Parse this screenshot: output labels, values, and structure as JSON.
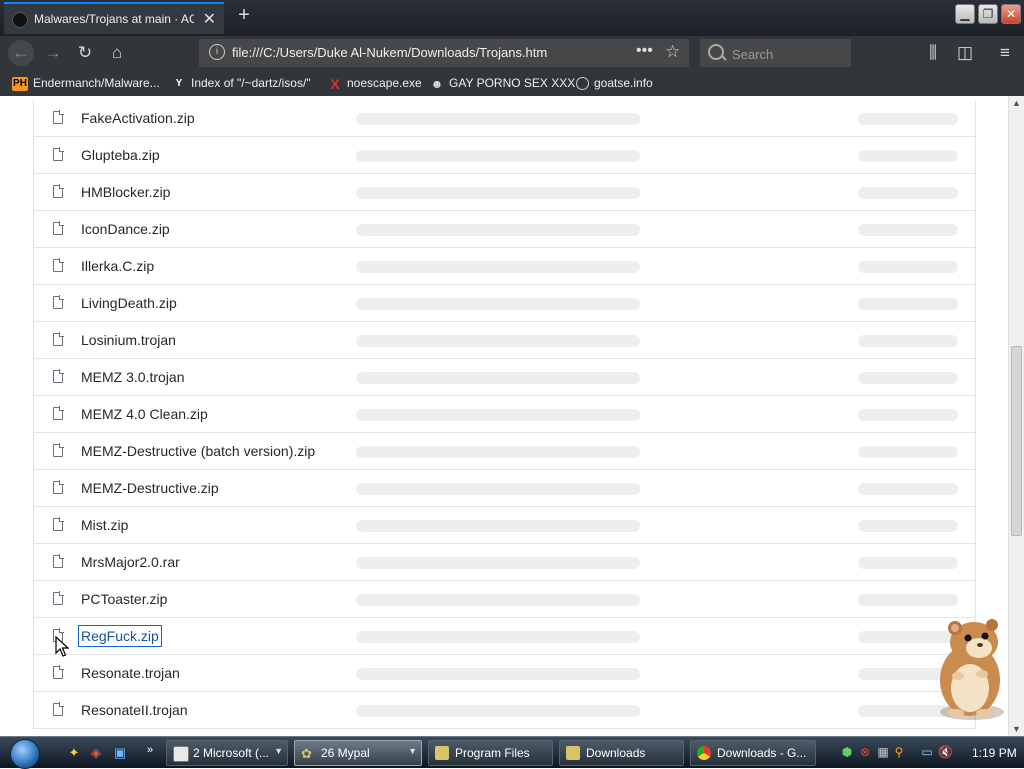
{
  "browser": {
    "tab_title": "Malwares/Trojans at main · AG",
    "new_tab_symbol": "+",
    "url": "file:///C:/Users/Duke Al-Nukem/Downloads/Trojans.htm",
    "search_placeholder": "Search",
    "accent_color": "#0a84ff"
  },
  "bookmarks": [
    {
      "icon": "PH",
      "label": "Endermanch/Malware..."
    },
    {
      "icon": "Y",
      "label": "Index of \"/~dartz/isos/\""
    },
    {
      "icon": "X",
      "label": "noescape.exe"
    },
    {
      "icon": "mask-icon",
      "label": "GAY PORNO SEX XXX"
    },
    {
      "icon": "globe-icon",
      "label": "goatse.info"
    }
  ],
  "files": [
    {
      "name": "FakeActivation.zip"
    },
    {
      "name": "Glupteba.zip"
    },
    {
      "name": "HMBlocker.zip"
    },
    {
      "name": "IconDance.zip"
    },
    {
      "name": "Illerka.C.zip"
    },
    {
      "name": "LivingDeath.zip"
    },
    {
      "name": "Losinium.trojan"
    },
    {
      "name": "MEMZ 3.0.trojan"
    },
    {
      "name": "MEMZ 4.0 Clean.zip"
    },
    {
      "name": "MEMZ-Destructive (batch version).zip"
    },
    {
      "name": "MEMZ-Destructive.zip"
    },
    {
      "name": "Mist.zip"
    },
    {
      "name": "MrsMajor2.0.rar"
    },
    {
      "name": "PCToaster.zip"
    },
    {
      "name": "RegFuck.zip",
      "focused": true
    },
    {
      "name": "Resonate.trojan"
    },
    {
      "name": "ResonateII.trojan"
    }
  ],
  "taskbar": {
    "buttons": [
      {
        "label": "2 Microsoft (...",
        "icon": "window-icon"
      },
      {
        "label": "26 Mypal",
        "icon": "mypal-icon",
        "active": true
      },
      {
        "label": "Program Files",
        "icon": "folder-icon"
      },
      {
        "label": "Downloads",
        "icon": "folder-icon"
      },
      {
        "label": "Downloads - G...",
        "icon": "chrome-icon"
      }
    ],
    "clock": "1:19 PM"
  }
}
